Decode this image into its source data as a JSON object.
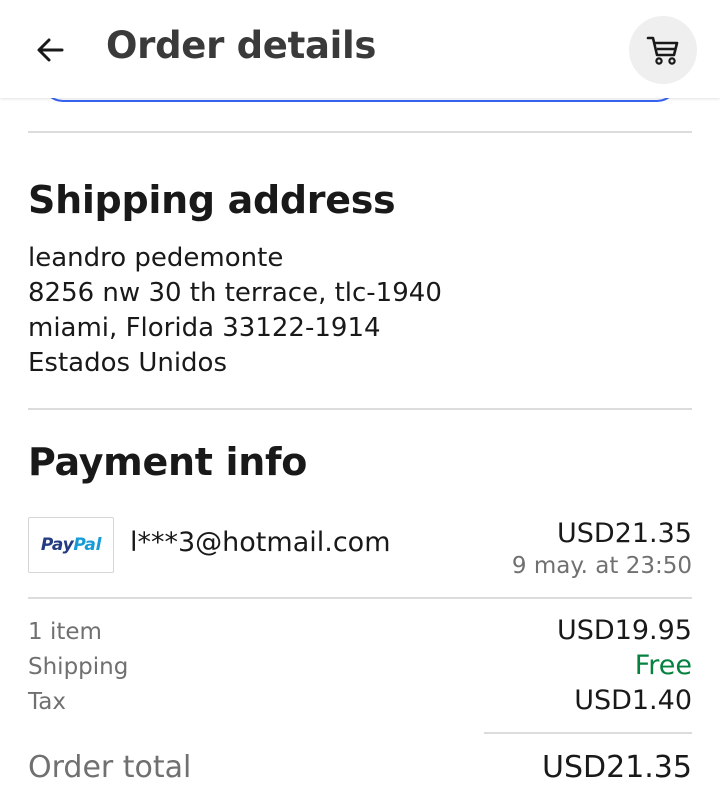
{
  "header": {
    "title": "Order details",
    "back_icon": "arrow-left-icon",
    "cart_icon": "cart-icon"
  },
  "shipping": {
    "heading": "Shipping address",
    "lines": [
      "leandro pedemonte",
      "8256 nw 30 th terrace, tlc-1940",
      "miami, Florida 33122-1914",
      "Estados Unidos"
    ]
  },
  "payment": {
    "heading": "Payment info",
    "method_logo": "PayPal",
    "email": "l***3@hotmail.com",
    "amount": "USD21.35",
    "date": "9 may. at 23:50"
  },
  "summary": {
    "rows": [
      {
        "label": "1 item",
        "value": "USD19.95"
      },
      {
        "label": "Shipping",
        "value": "Free"
      },
      {
        "label": "Tax",
        "value": "USD1.40"
      }
    ],
    "total_label": "Order total",
    "total_value": "USD21.35"
  },
  "colors": {
    "accent_blue": "#3665f3",
    "free_green": "#05823f",
    "paypal_dark": "#253b80",
    "paypal_light": "#179bd7"
  }
}
